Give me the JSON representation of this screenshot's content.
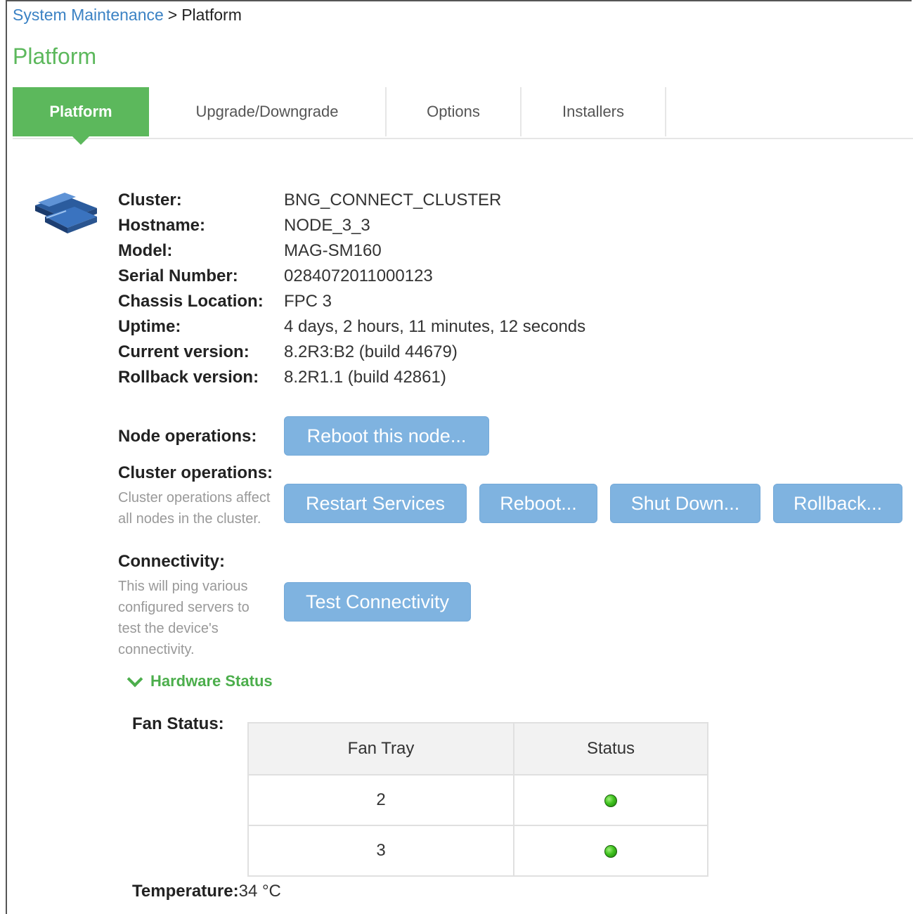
{
  "breadcrumb": {
    "parent": "System Maintenance",
    "separator": ">",
    "current": "Platform"
  },
  "page_title": "Platform",
  "tabs": [
    {
      "label": "Platform",
      "active": true
    },
    {
      "label": "Upgrade/Downgrade",
      "active": false
    },
    {
      "label": "Options",
      "active": false
    },
    {
      "label": "Installers",
      "active": false
    }
  ],
  "info": [
    {
      "label": "Cluster:",
      "value": "BNG_CONNECT_CLUSTER"
    },
    {
      "label": "Hostname:",
      "value": "NODE_3_3"
    },
    {
      "label": "Model:",
      "value": "MAG-SM160"
    },
    {
      "label": "Serial Number:",
      "value": "0284072011000123"
    },
    {
      "label": "Chassis Location:",
      "value": "FPC 3"
    },
    {
      "label": "Uptime:",
      "value": "4 days, 2 hours, 11 minutes, 12 seconds"
    },
    {
      "label": "Current version:",
      "value": "8.2R3:B2 (build 44679)"
    },
    {
      "label": "Rollback version:",
      "value": "8.2R1.1 (build 42861)"
    }
  ],
  "node_ops": {
    "label": "Node operations:",
    "reboot_button": "Reboot this node..."
  },
  "cluster_ops": {
    "label": "Cluster operations:",
    "description": "Cluster operations affect all nodes in the cluster.",
    "restart_button": "Restart Services",
    "reboot_button": "Reboot...",
    "shutdown_button": "Shut Down...",
    "rollback_button": "Rollback..."
  },
  "connectivity": {
    "label": "Connectivity:",
    "description": "This will ping various configured servers to test the device's connectivity.",
    "test_button": "Test Connectivity"
  },
  "hardware": {
    "toggle_label": "Hardware Status",
    "fan_label": "Fan Status:",
    "fan_columns": [
      "Fan Tray",
      "Status"
    ],
    "fan_rows": [
      {
        "tray": "2",
        "status": "ok"
      },
      {
        "tray": "3",
        "status": "ok"
      }
    ],
    "temperature_label": "Temperature:",
    "temperature_value": "34 °C"
  },
  "colors": {
    "accent_green": "#5cb85c",
    "button_blue": "#7fb3e0",
    "link_blue": "#3b82c4",
    "status_ok": "#3fc21e"
  }
}
